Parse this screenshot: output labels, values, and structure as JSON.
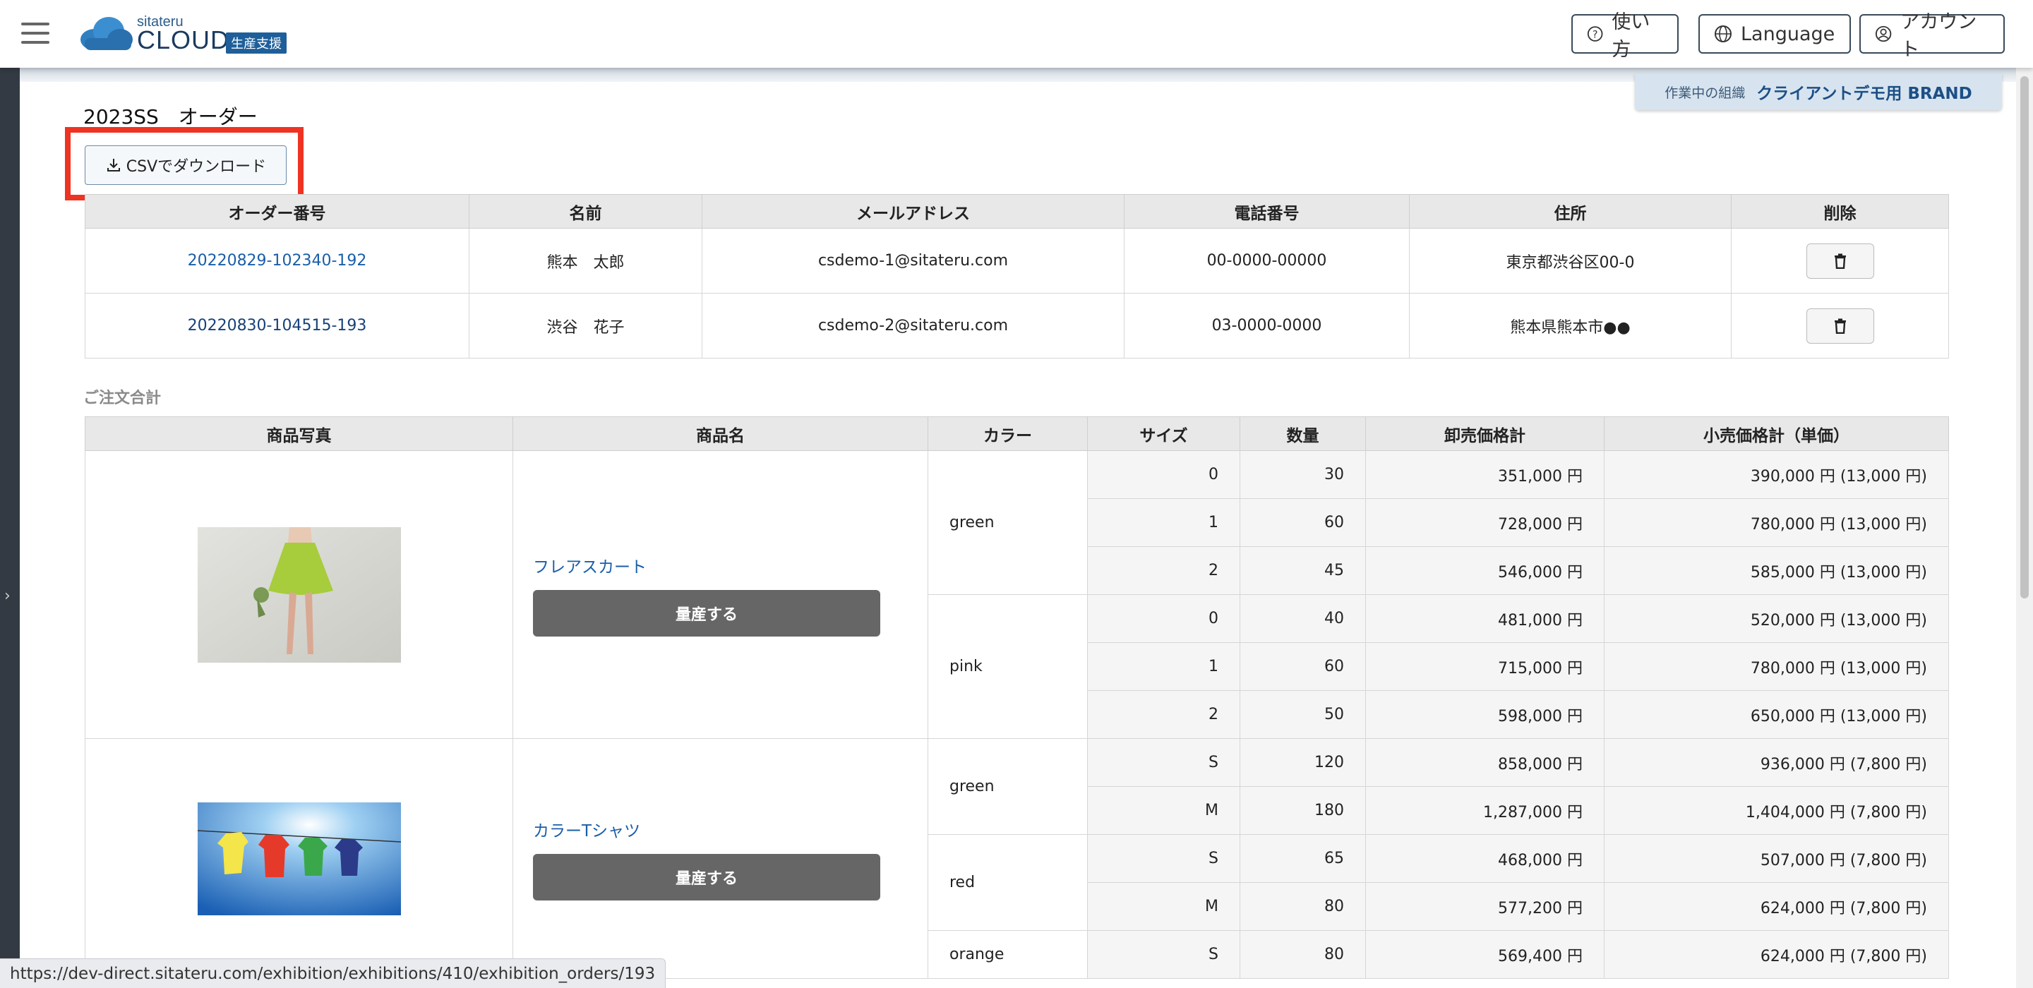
{
  "header": {
    "logo_small": "sitateru",
    "logo_big": "CLOUD",
    "logo_badge": "生産支援",
    "buttons": {
      "help": "使い方",
      "language": "Language",
      "account": "アカウント"
    }
  },
  "org": {
    "label": "作業中の組織",
    "name": "クライアントデモ用 BRAND"
  },
  "page": {
    "title": "2023SS　オーダー",
    "csv_button": "CSVでダウンロード"
  },
  "orders": {
    "headers": [
      "オーダー番号",
      "名前",
      "メールアドレス",
      "電話番号",
      "住所",
      "削除"
    ],
    "rows": [
      {
        "order_no": "20220829-102340-192",
        "name": "熊本　太郎",
        "email": "csdemo-1@sitateru.com",
        "phone": "00-0000-00000",
        "address": "東京都渋谷区00-0"
      },
      {
        "order_no": "20220830-104515-193",
        "name": "渋谷　花子",
        "email": "csdemo-2@sitateru.com",
        "phone": "03-0000-0000",
        "address": "熊本県熊本市●●"
      }
    ]
  },
  "summary": {
    "label": "ご注文合計",
    "headers": [
      "商品写真",
      "商品名",
      "カラー",
      "サイズ",
      "数量",
      "卸売価格計",
      "小売価格計（単価）"
    ],
    "mass_button": "量産する",
    "products": [
      {
        "name": "フレアスカート",
        "colors": [
          {
            "color": "green",
            "rows": [
              {
                "size": "0",
                "qty": "30",
                "wholesale": "351,000 円",
                "retail": "390,000 円 (13,000 円)"
              },
              {
                "size": "1",
                "qty": "60",
                "wholesale": "728,000 円",
                "retail": "780,000 円 (13,000 円)"
              },
              {
                "size": "2",
                "qty": "45",
                "wholesale": "546,000 円",
                "retail": "585,000 円 (13,000 円)"
              }
            ]
          },
          {
            "color": "pink",
            "rows": [
              {
                "size": "0",
                "qty": "40",
                "wholesale": "481,000 円",
                "retail": "520,000 円 (13,000 円)"
              },
              {
                "size": "1",
                "qty": "60",
                "wholesale": "715,000 円",
                "retail": "780,000 円 (13,000 円)"
              },
              {
                "size": "2",
                "qty": "50",
                "wholesale": "598,000 円",
                "retail": "650,000 円 (13,000 円)"
              }
            ]
          }
        ]
      },
      {
        "name": "カラーTシャツ",
        "colors": [
          {
            "color": "green",
            "rows": [
              {
                "size": "S",
                "qty": "120",
                "wholesale": "858,000 円",
                "retail": "936,000 円 (7,800 円)"
              },
              {
                "size": "M",
                "qty": "180",
                "wholesale": "1,287,000 円",
                "retail": "1,404,000 円 (7,800 円)"
              }
            ]
          },
          {
            "color": "red",
            "rows": [
              {
                "size": "S",
                "qty": "65",
                "wholesale": "468,000 円",
                "retail": "507,000 円 (7,800 円)"
              },
              {
                "size": "M",
                "qty": "80",
                "wholesale": "577,200 円",
                "retail": "624,000 円 (7,800 円)"
              }
            ]
          },
          {
            "color": "orange",
            "rows": [
              {
                "size": "S",
                "qty": "80",
                "wholesale": "569,400 円",
                "retail": "624,000 円 (7,800 円)"
              }
            ]
          }
        ]
      }
    ]
  },
  "status_url": "https://dev-direct.sitateru.com/exhibition/exhibitions/410/exhibition_orders/193",
  "colors": {
    "accent": "#1a5ea8",
    "highlight": "#ee3322",
    "mass_button": "#666666"
  }
}
